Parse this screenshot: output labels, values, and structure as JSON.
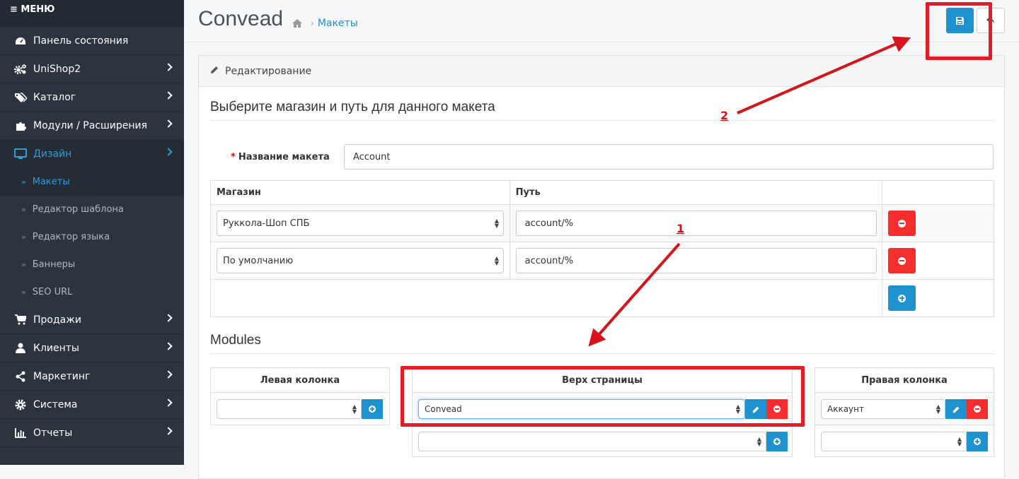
{
  "sidebar": {
    "menu_label": "≡ МЕНЮ",
    "items": [
      {
        "label": "Панель состояния",
        "icon": "dashboard-icon"
      },
      {
        "label": "UniShop2",
        "icon": "cogs-icon"
      },
      {
        "label": "Каталог",
        "icon": "tags-icon"
      },
      {
        "label": "Модули / Расширения",
        "icon": "puzzle-icon"
      },
      {
        "label": "Дизайн",
        "icon": "monitor-icon"
      }
    ],
    "design_sub": [
      {
        "label": "Макеты"
      },
      {
        "label": "Редактор шаблона"
      },
      {
        "label": "Редактор языка"
      },
      {
        "label": "Баннеры"
      },
      {
        "label": "SEO URL"
      }
    ],
    "items_after": [
      {
        "label": "Продажи",
        "icon": "cart-icon"
      },
      {
        "label": "Клиенты",
        "icon": "user-icon"
      },
      {
        "label": "Маркетинг",
        "icon": "share-icon"
      },
      {
        "label": "Система",
        "icon": "cog-icon"
      },
      {
        "label": "Отчеты",
        "icon": "bar-chart-icon"
      }
    ]
  },
  "header": {
    "title": "Convead",
    "breadcrumb": "Макеты"
  },
  "panel": {
    "heading": "Редактирование",
    "section_title": "Выберите магазин и путь для данного макета",
    "layout_name_label": "Название макета",
    "layout_name_value": "Account",
    "store_table": {
      "col_store": "Магазин",
      "col_path": "Путь",
      "rows": [
        {
          "store": "Руккола-Шоп СПБ",
          "path": "account/%"
        },
        {
          "store": "По умолчанию",
          "path": "account/%"
        }
      ]
    },
    "modules_title": "Modules",
    "columns": {
      "left": {
        "header": "Левая колонка",
        "select": ""
      },
      "top": {
        "header": "Верх страницы",
        "select": "Convead",
        "add_select": ""
      },
      "right": {
        "header": "Правая колонка",
        "select": "Аккаунт",
        "add_select": ""
      }
    }
  },
  "annotations": {
    "one": "1",
    "two": "2",
    "color": "#e31c25"
  },
  "colors": {
    "primary": "#1e91cf",
    "danger": "#f52d2d",
    "sidebar": "#2c3440"
  }
}
